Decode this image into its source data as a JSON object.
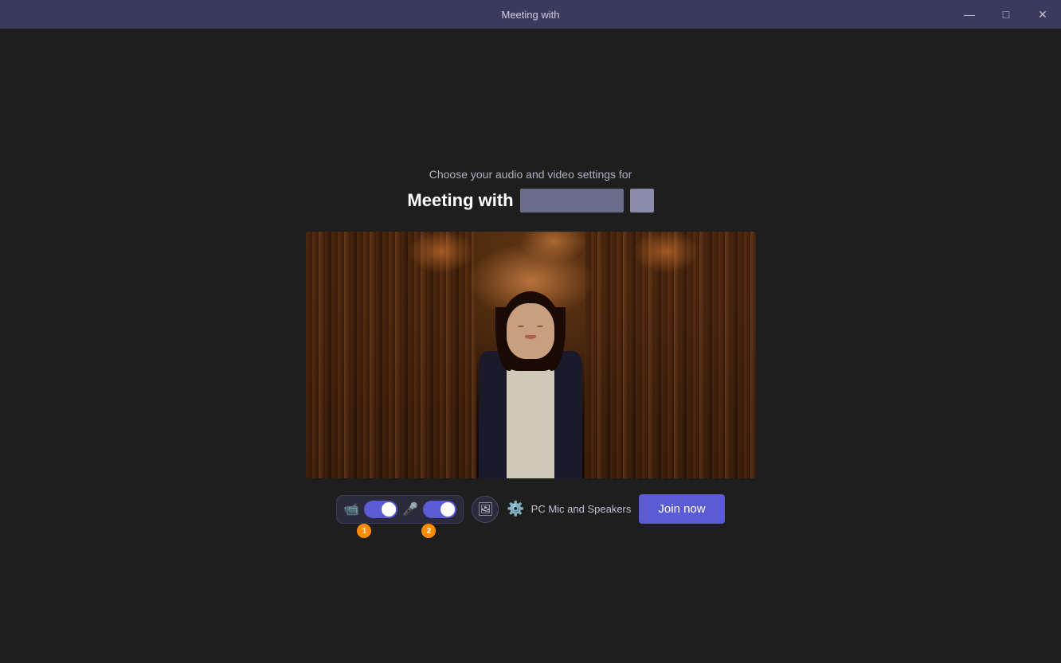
{
  "titlebar": {
    "title": "Meeting with",
    "minimize_btn": "—",
    "maximize_btn": "⬜",
    "close_btn": "✕"
  },
  "main": {
    "subtitle": "Choose your audio and video settings for",
    "meeting_title": "Meeting with",
    "redacted_name": "",
    "video_preview_alt": "Camera preview showing person in library background"
  },
  "controls": {
    "camera_toggle_on": true,
    "mic_toggle_on": true,
    "effects_label": "Background effects",
    "badge_1": "1",
    "badge_2": "2",
    "audio_device_label": "PC Mic and Speakers",
    "join_btn_label": "Join now"
  },
  "icons": {
    "camera": "📹",
    "microphone": "🎤",
    "effects": "🎭",
    "gear": "⚙️"
  }
}
